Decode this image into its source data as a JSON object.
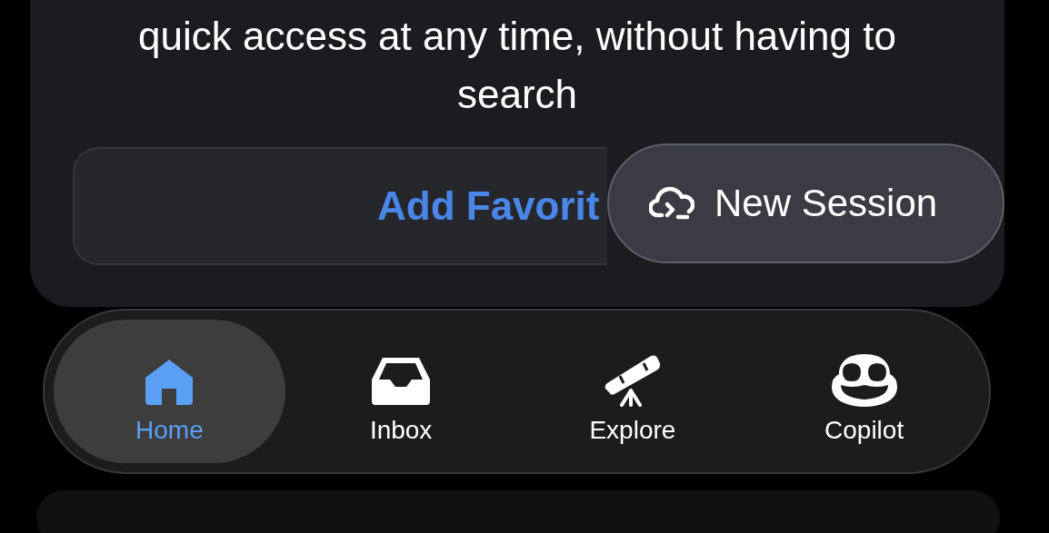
{
  "card": {
    "text": "quick access at any time, without having to search",
    "add_button": "Add Favorit"
  },
  "new_session_button": {
    "label": "New Session"
  },
  "tab_bar": [
    {
      "label": "Home",
      "selected": true
    },
    {
      "label": "Inbox",
      "selected": false
    },
    {
      "label": "Explore",
      "selected": false
    },
    {
      "label": "Copilot",
      "selected": false
    }
  ]
}
